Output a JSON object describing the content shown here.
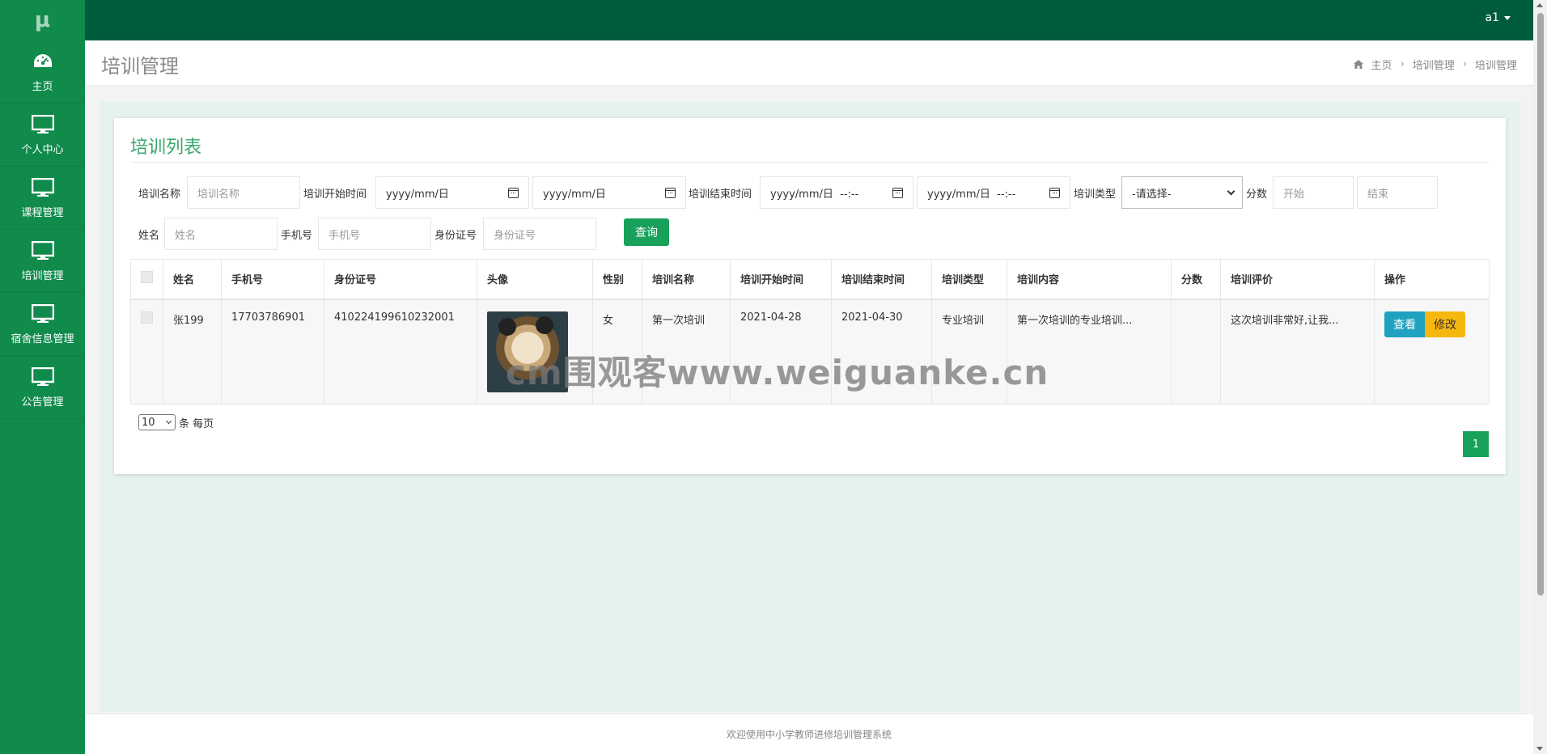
{
  "app": {
    "logo": "μ",
    "user": "a1"
  },
  "sidebar": {
    "items": [
      {
        "label": "主页",
        "icon": "dashboard-icon"
      },
      {
        "label": "个人中心",
        "icon": "monitor-icon"
      },
      {
        "label": "课程管理",
        "icon": "monitor-icon"
      },
      {
        "label": "培训管理",
        "icon": "monitor-icon"
      },
      {
        "label": "宿舍信息管理",
        "icon": "monitor-icon"
      },
      {
        "label": "公告管理",
        "icon": "monitor-icon"
      }
    ]
  },
  "header": {
    "title": "培训管理",
    "breadcrumb": [
      "主页",
      "培训管理",
      "培训管理"
    ]
  },
  "panel": {
    "title": "培训列表"
  },
  "filters": {
    "name_label": "培训名称",
    "name_placeholder": "培训名称",
    "start_label": "培训开始时间",
    "start_from": "yyyy/mm/日",
    "start_to": "yyyy/mm/日",
    "end_label": "培训结束时间",
    "end_from": "yyyy/mm/日  --:--",
    "end_to": "yyyy/mm/日  --:--",
    "type_label": "培训类型",
    "type_value": "-请选择-",
    "score_label": "分数",
    "score_from": "开始",
    "score_to": "结束",
    "person_label": "姓名",
    "person_placeholder": "姓名",
    "phone_label": "手机号",
    "phone_placeholder": "手机号",
    "id_label": "身份证号",
    "id_placeholder": "身份证号",
    "query_button": "查询"
  },
  "table": {
    "headers": [
      "姓名",
      "手机号",
      "身份证号",
      "头像",
      "性别",
      "培训名称",
      "培训开始时间",
      "培训结束时间",
      "培训类型",
      "培训内容",
      "分数",
      "培训评价",
      "操作"
    ],
    "rows": [
      {
        "name": "张199",
        "phone": "17703786901",
        "id_number": "410224199610232001",
        "gender": "女",
        "training_name": "第一次培训",
        "start": "2021-04-28",
        "end": "2021-04-30",
        "type": "专业培训",
        "content": "第一次培训的专业培训...",
        "score": "",
        "evaluation": "这次培训非常好,让我...",
        "view_button": "查看",
        "edit_button": "修改"
      }
    ]
  },
  "pagination": {
    "page_size": "10",
    "page_size_suffix": "条 每页",
    "current_page": "1"
  },
  "watermark": "cm围观客www.weiguanke.cn",
  "footer": {
    "text": "欢迎使用中小学教师进修培训管理系统"
  },
  "colors": {
    "sidebar": "#108b4c",
    "topbar": "#005c3e",
    "accent": "#18a15b",
    "info": "#1fa2bf",
    "warning": "#f6b70f"
  }
}
